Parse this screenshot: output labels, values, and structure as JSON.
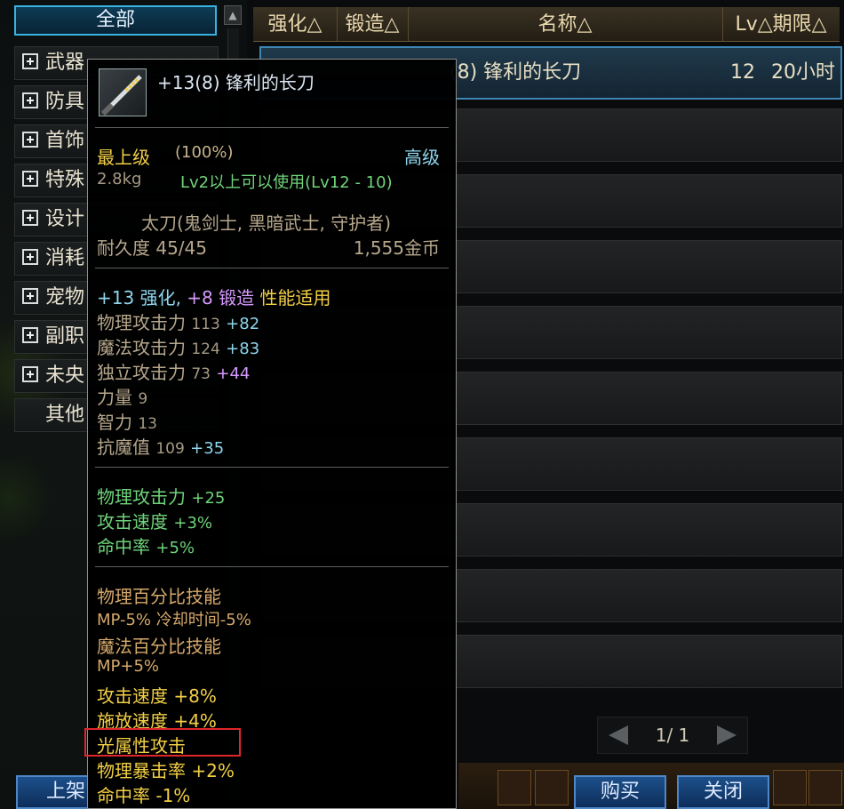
{
  "left": {
    "all_tab": "全部",
    "categories": [
      {
        "label": "武器"
      },
      {
        "label": "防具"
      },
      {
        "label": "首饰"
      },
      {
        "label": "特殊"
      },
      {
        "label": "设计"
      },
      {
        "label": "消耗"
      },
      {
        "label": "宠物"
      },
      {
        "label": "副职"
      },
      {
        "label": "未央"
      }
    ],
    "other": "其他",
    "bottom_button": "上架"
  },
  "table": {
    "headers": {
      "enhance": "强化△",
      "forge": "锻造△",
      "name": "名称△",
      "lv_period": "Lv△期限△"
    },
    "selected_row": {
      "name": "(8) 锋利的长刀",
      "lv": "12",
      "period": "20小时"
    }
  },
  "pager": {
    "text": "1/ 1"
  },
  "actions": {
    "buy": "购买",
    "close": "关闭"
  },
  "tooltip": {
    "title": "+13(8) 锋利的长刀",
    "grade": "最上级",
    "grade_pct": "(100%)",
    "rarity": "高级",
    "weight": "2.8kg",
    "level_req": "Lv2以上可以使用(Lv12 - 10)",
    "type": "太刀(鬼剑士, 黑暗武士, 守护者)",
    "durability": "耐久度 45/45",
    "price": "1,555金币",
    "enh_plus": "+13",
    "enh_word": "强化,",
    "forge_plus": "+8",
    "forge_word": "锻造",
    "perf": "性能适用",
    "stats": [
      {
        "label": "物理攻击力",
        "base": "113",
        "bonus": "+82"
      },
      {
        "label": "魔法攻击力",
        "base": "124",
        "bonus": "+83"
      },
      {
        "label": "独立攻击力",
        "base": "73",
        "bonus": "+44"
      },
      {
        "label": "力量",
        "base": "9",
        "bonus": ""
      },
      {
        "label": "智力",
        "base": "13",
        "bonus": ""
      },
      {
        "label": "抗魔值",
        "base": "109",
        "bonus": "+35"
      }
    ],
    "green_stats": [
      {
        "label": "物理攻击力",
        "value": "+25"
      },
      {
        "label": "攻击速度",
        "value": "+3%"
      },
      {
        "label": "命中率",
        "value": "+5%"
      }
    ],
    "extra": [
      "物理百分比技能",
      " MP-5% 冷却时间-5%",
      "魔法百分比技能",
      " MP+5%",
      "攻击速度 +8%",
      "施放速度 +4%",
      "光属性攻击",
      "物理暴击率 +2%",
      "命中率 -1%"
    ]
  },
  "colors": {
    "gold": "#f2cf45",
    "green": "#6fd37a",
    "cyan": "#8ed6ee",
    "purple": "#d69aff",
    "highlight_border": "#e0262a"
  },
  "icons": {
    "item": "katana-icon",
    "plus": "plus-box-icon",
    "prev": "triangle-left-icon",
    "next": "triangle-right-icon"
  }
}
